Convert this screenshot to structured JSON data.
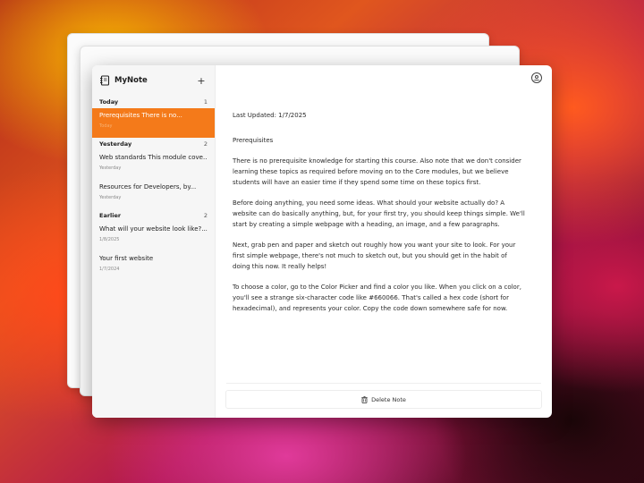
{
  "app": {
    "name": "MyNote",
    "add_label": "+",
    "accent_color": "#f47a1a"
  },
  "groups": [
    {
      "label": "Today",
      "count": "1"
    },
    {
      "label": "Yesterday",
      "count": "2"
    },
    {
      "label": "Earlier",
      "count": "2"
    }
  ],
  "notes": [
    {
      "title": "Prerequisites There is no...",
      "date": "Today"
    },
    {
      "title": "Web standards This module cove...",
      "date": "Yesterday"
    },
    {
      "title": "Resources for Developers, by...",
      "date": "Yesterday"
    },
    {
      "title": "What will your website look like?...",
      "date": "1/8/2025"
    },
    {
      "title": "Your first website",
      "date": "1/7/2024"
    }
  ],
  "editor": {
    "last_updated": "Last Updated: 1/7/2025",
    "heading": "Prerequisites",
    "paragraphs": [
      "There is no prerequisite knowledge for starting this course. Also note that we don't consider learning these topics as required before moving on to the Core modules, but we believe students will have an easier time if they spend some time on these topics first.",
      "Before doing anything, you need some ideas. What should your website actually do? A website can do basically anything, but, for your first try, you should keep things simple. We'll start by creating a simple webpage with a heading, an image, and a few paragraphs.",
      "Next, grab pen and paper and sketch out roughly how you want your site to look. For your first simple webpage, there's not much to sketch out, but you should get in the habit of doing this now. It really helps!",
      "To choose a color, go to the Color Picker and find a color you like. When you click on a color, you'll see a strange six-character code like #660066. That's called a hex code (short for hexadecimal), and represents your color. Copy the code down somewhere safe for now."
    ],
    "delete_label": "Delete Note"
  },
  "icons": {
    "logo": "notebook-icon",
    "profile": "user-circle-icon",
    "delete": "trash-icon"
  }
}
